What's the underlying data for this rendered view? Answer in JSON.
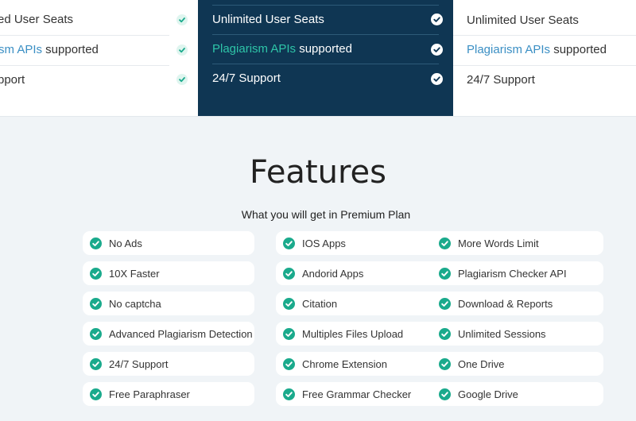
{
  "pricing": {
    "left": {
      "rows": [
        {
          "pre": "ed User Seats",
          "hl": "",
          "post": ""
        },
        {
          "pre": "",
          "hl": "sm APIs",
          "post": " supported"
        },
        {
          "pre": "pport",
          "hl": "",
          "post": ""
        }
      ]
    },
    "middle": {
      "rows": [
        {
          "pre": "Unlimited User Seats",
          "hl": "",
          "post": ""
        },
        {
          "pre": "",
          "hl": "Plagiarism APIs",
          "post": " supported"
        },
        {
          "pre": "24/7 Support",
          "hl": "",
          "post": ""
        }
      ]
    },
    "right": {
      "rows": [
        {
          "pre": "Unlimited User Seats",
          "hl": "",
          "post": ""
        },
        {
          "pre": "",
          "hl": "Plagiarism APIs",
          "post": " supported"
        },
        {
          "pre": "24/7 Support",
          "hl": "",
          "post": ""
        }
      ]
    }
  },
  "features": {
    "title": "Features",
    "subtitle": "What you will get in Premium Plan",
    "columns": [
      [
        "No Ads",
        "10X Faster",
        "No captcha",
        "Advanced Plagiarism Detection",
        "24/7 Support",
        "Free Paraphraser"
      ],
      [
        "IOS Apps",
        "Andorid Apps",
        "Citation",
        "Multiples Files Upload",
        "Chrome Extension",
        "Free Grammar Checker"
      ],
      [
        "More Words Limit",
        "Plagiarism Checker API",
        "Download & Reports",
        "Unlimited Sessions",
        "One Drive",
        "Google Drive"
      ]
    ]
  },
  "colors": {
    "accent": "#1aaa8c",
    "navy": "#0f3653",
    "link": "#3b8fc4"
  }
}
